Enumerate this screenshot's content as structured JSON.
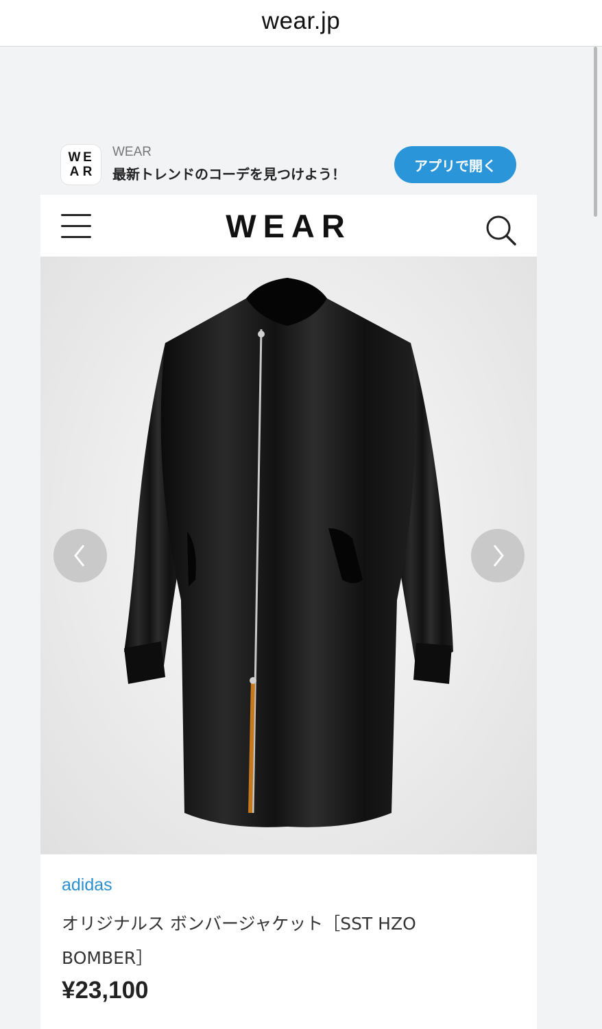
{
  "browser": {
    "url": "wear.jp"
  },
  "app_banner": {
    "logo_letters": [
      "W",
      "E",
      "A",
      "R"
    ],
    "app_name": "WEAR",
    "tagline": "最新トレンドのコーデを見つけよう！",
    "open_button_label": "アプリで開く"
  },
  "header": {
    "logo": "WEAR",
    "menu_icon": "hamburger-menu-icon",
    "search_icon": "search-icon"
  },
  "product": {
    "image_subject": "black-long-bomber-jacket",
    "brand": "adidas",
    "name": "オリジナルス ボンバージャケット［SST HZO BOMBER］",
    "price": "¥23,100"
  },
  "colors": {
    "accent_blue": "#2a95d9",
    "brand_link": "#2a8fcf",
    "page_bg": "#f2f3f5"
  }
}
